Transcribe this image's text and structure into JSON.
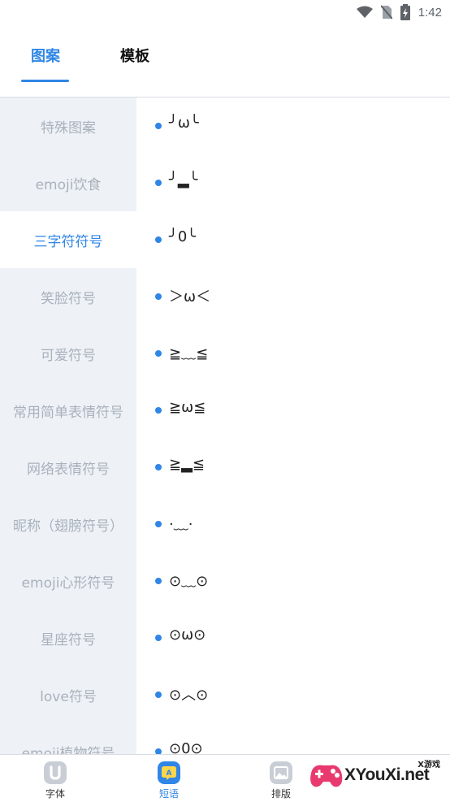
{
  "status_bar": {
    "time": "1:42",
    "icons": [
      "wifi-icon",
      "no-sim-icon",
      "battery-charging-icon"
    ]
  },
  "tabs": [
    {
      "label": "图案",
      "active": true
    },
    {
      "label": "模板",
      "active": false
    }
  ],
  "categories": [
    {
      "label": "特殊图案"
    },
    {
      "label": "emoji饮食"
    },
    {
      "label": "三字符符号",
      "active": true
    },
    {
      "label": "笑脸符号"
    },
    {
      "label": "可爱符号"
    },
    {
      "label": "常用简单表情符号"
    },
    {
      "label": "网络表情符号"
    },
    {
      "label": "昵称（翅膀符号）"
    },
    {
      "label": "emoji心形符号"
    },
    {
      "label": "星座符号"
    },
    {
      "label": "love符号"
    },
    {
      "label": "emoji植物符号"
    }
  ],
  "symbols": [
    {
      "text": "╯ω╰"
    },
    {
      "text": "╯▂╰"
    },
    {
      "text": "╯0╰"
    },
    {
      "text": "＞ω＜"
    },
    {
      "text": "≧﹏≦"
    },
    {
      "text": "≧ω≦"
    },
    {
      "text": "≧▂≦"
    },
    {
      "text": "·﹏·"
    },
    {
      "text": "⊙﹏⊙"
    },
    {
      "text": "⊙ω⊙"
    },
    {
      "text": "⊙︿⊙"
    },
    {
      "text": "⊙0⊙"
    }
  ],
  "bottom_nav": [
    {
      "label": "字体",
      "icon": "font-u-icon"
    },
    {
      "label": "短语",
      "icon": "phrase-bubble-icon",
      "active": true
    },
    {
      "label": "排版",
      "icon": "image-layout-icon"
    }
  ],
  "watermark": {
    "text": "XYouXi.net",
    "small": "X游戏"
  },
  "colors": {
    "accent": "#2f86e6",
    "sidebar_bg": "#eef2f7",
    "inactive_text": "#a9b1bb"
  }
}
